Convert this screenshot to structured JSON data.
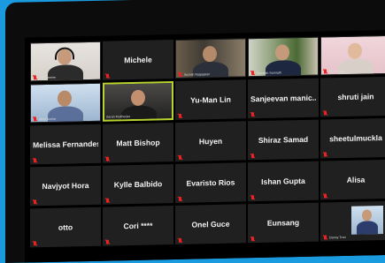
{
  "meeting": {
    "participants": [
      {
        "name": "",
        "footer": "Alex Lermer",
        "video": "wall",
        "muted": true
      },
      {
        "name": "Michele",
        "footer": "",
        "video": "none",
        "muted": true
      },
      {
        "name": "",
        "footer": "Suresh Nagappan",
        "video": "room",
        "muted": true
      },
      {
        "name": "",
        "footer": "Ramesh Samrath",
        "video": "office",
        "muted": true
      },
      {
        "name": "",
        "footer": "Shruti Jain",
        "video": "pink",
        "muted": true
      },
      {
        "name": "",
        "footer": "Akhil Kumar",
        "video": "blue",
        "muted": true
      },
      {
        "name": "",
        "footer": "Sarah Mukherjee",
        "video": "dark",
        "muted": false,
        "active": true
      },
      {
        "name": "Yu-Man Lin",
        "footer": "",
        "video": "none",
        "muted": true
      },
      {
        "name": "Sanjeevan manic...",
        "footer": "",
        "video": "none",
        "muted": true
      },
      {
        "name": "shruti jain",
        "footer": "",
        "video": "none",
        "muted": true
      },
      {
        "name": "Melissa Fernandes",
        "footer": "",
        "video": "none",
        "muted": true
      },
      {
        "name": "Matt Bishop",
        "footer": "",
        "video": "none",
        "muted": true
      },
      {
        "name": "Huyen",
        "footer": "",
        "video": "none",
        "muted": true
      },
      {
        "name": "Shiraz Samad",
        "footer": "",
        "video": "none",
        "muted": true
      },
      {
        "name": "sheetulmuckla",
        "footer": "",
        "video": "none",
        "muted": true
      },
      {
        "name": "Navjyot Hora",
        "footer": "",
        "video": "none",
        "muted": true
      },
      {
        "name": "Kylle Balbido",
        "footer": "",
        "video": "none",
        "muted": true
      },
      {
        "name": "Evaristo Rios",
        "footer": "",
        "video": "none",
        "muted": true
      },
      {
        "name": "Ishan Gupta",
        "footer": "",
        "video": "none",
        "muted": true
      },
      {
        "name": "Alisa",
        "footer": "",
        "video": "none",
        "muted": true
      },
      {
        "name": "otto",
        "footer": "",
        "video": "none",
        "muted": true
      },
      {
        "name": "Cori ****",
        "footer": "",
        "video": "none",
        "muted": true
      },
      {
        "name": "Onel Guce",
        "footer": "",
        "video": "none",
        "muted": true
      },
      {
        "name": "Eunsang",
        "footer": "",
        "video": "none",
        "muted": true
      },
      {
        "name": "",
        "footer": "Danny Tran",
        "video": "small",
        "muted": true
      }
    ]
  },
  "colors": {
    "tile_bg": "#202020",
    "active_border": "#b8d32d",
    "muted_icon": "#e22",
    "outer_frame": "#1a9be0"
  }
}
